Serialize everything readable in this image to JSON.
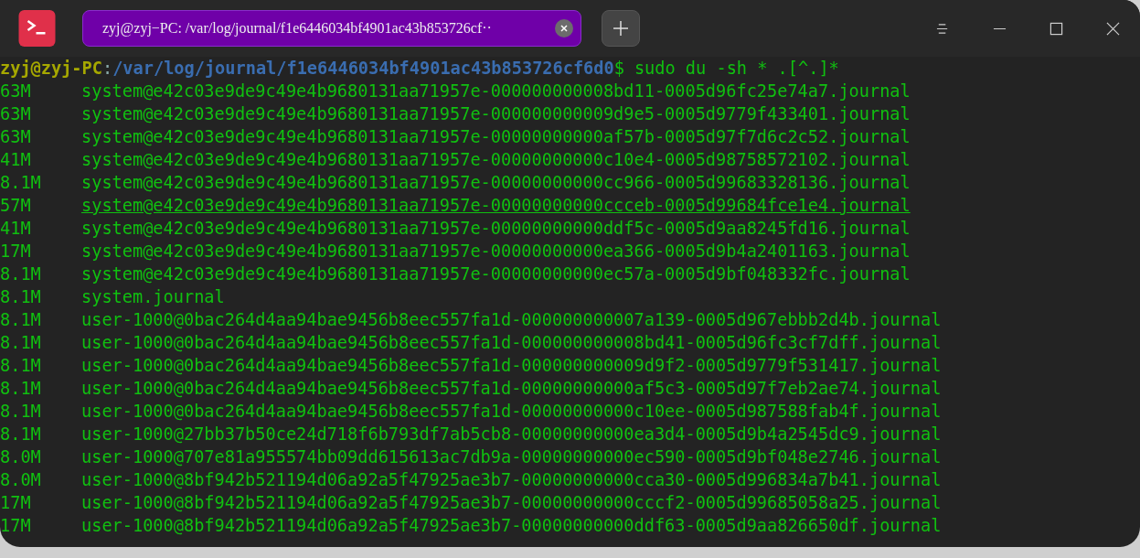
{
  "window": {
    "tab_title": "zyj@zyj−PC: /var/log/journal/f1e6446034bf4901ac43b853726cf··"
  },
  "prompt": {
    "user_host": "zyj@zyj-PC",
    "separator": ":",
    "path": "/var/log/journal/f1e6446034bf4901ac43b853726cf6d0",
    "symbol": "$",
    "command": "sudo du -sh * .[^.]*"
  },
  "rows": [
    {
      "size": "63M",
      "name": "system@e42c03e9de9c49e4b9680131aa71957e-000000000008bd11-0005d96fc25e74a7.journal",
      "underlined": false
    },
    {
      "size": "63M",
      "name": "system@e42c03e9de9c49e4b9680131aa71957e-000000000009d9e5-0005d9779f433401.journal",
      "underlined": false
    },
    {
      "size": "63M",
      "name": "system@e42c03e9de9c49e4b9680131aa71957e-00000000000af57b-0005d97f7d6c2c52.journal",
      "underlined": false
    },
    {
      "size": "41M",
      "name": "system@e42c03e9de9c49e4b9680131aa71957e-00000000000c10e4-0005d98758572102.journal",
      "underlined": false
    },
    {
      "size": "8.1M",
      "name": "system@e42c03e9de9c49e4b9680131aa71957e-00000000000cc966-0005d99683328136.journal",
      "underlined": false
    },
    {
      "size": "57M",
      "name": "system@e42c03e9de9c49e4b9680131aa71957e-00000000000ccceb-0005d99684fce1e4.journal",
      "underlined": true
    },
    {
      "size": "41M",
      "name": "system@e42c03e9de9c49e4b9680131aa71957e-00000000000ddf5c-0005d9aa8245fd16.journal",
      "underlined": false
    },
    {
      "size": "17M",
      "name": "system@e42c03e9de9c49e4b9680131aa71957e-00000000000ea366-0005d9b4a2401163.journal",
      "underlined": false
    },
    {
      "size": "8.1M",
      "name": "system@e42c03e9de9c49e4b9680131aa71957e-00000000000ec57a-0005d9bf048332fc.journal",
      "underlined": false
    },
    {
      "size": "8.1M",
      "name": "system.journal",
      "underlined": false
    },
    {
      "size": "8.1M",
      "name": "user-1000@0bac264d4aa94bae9456b8eec557fa1d-000000000007a139-0005d967ebbb2d4b.journal",
      "underlined": false
    },
    {
      "size": "8.1M",
      "name": "user-1000@0bac264d4aa94bae9456b8eec557fa1d-000000000008bd41-0005d96fc3cf7dff.journal",
      "underlined": false
    },
    {
      "size": "8.1M",
      "name": "user-1000@0bac264d4aa94bae9456b8eec557fa1d-000000000009d9f2-0005d9779f531417.journal",
      "underlined": false
    },
    {
      "size": "8.1M",
      "name": "user-1000@0bac264d4aa94bae9456b8eec557fa1d-00000000000af5c3-0005d97f7eb2ae74.journal",
      "underlined": false
    },
    {
      "size": "8.1M",
      "name": "user-1000@0bac264d4aa94bae9456b8eec557fa1d-00000000000c10ee-0005d987588fab4f.journal",
      "underlined": false
    },
    {
      "size": "8.1M",
      "name": "user-1000@27bb37b50ce24d718f6b793df7ab5cb8-00000000000ea3d4-0005d9b4a2545dc9.journal",
      "underlined": false
    },
    {
      "size": "8.0M",
      "name": "user-1000@707e81a955574bb09dd615613ac7db9a-00000000000ec590-0005d9bf048e2746.journal",
      "underlined": false
    },
    {
      "size": "8.0M",
      "name": "user-1000@8bf942b521194d06a92a5f47925ae3b7-00000000000cca30-0005d996834a7b41.journal",
      "underlined": false
    },
    {
      "size": "17M",
      "name": "user-1000@8bf942b521194d06a92a5f47925ae3b7-00000000000cccf2-0005d99685058a25.journal",
      "underlined": false
    },
    {
      "size": "17M",
      "name": "user-1000@8bf942b521194d06a92a5f47925ae3b7-00000000000ddf63-0005d9aa826650df.journal",
      "underlined": false
    }
  ]
}
